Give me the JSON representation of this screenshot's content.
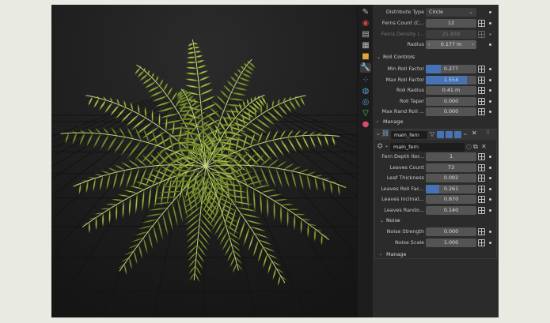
{
  "panel": {
    "top_rows": [
      {
        "label": "Distribute Type",
        "value": "Circle",
        "kind": "dropdown"
      },
      {
        "label": "Ferns Count (C...",
        "value": "12",
        "kind": "number"
      },
      {
        "label": "Ferns Density (...",
        "value": "21.839",
        "kind": "number",
        "disabled": true
      },
      {
        "label": "Radius",
        "value": "0.177 m",
        "kind": "slider"
      }
    ],
    "roll_controls_title": "Roll Controls",
    "roll_rows": [
      {
        "label": "Min Roll Factor",
        "value": "0.277",
        "fill": 0.3
      },
      {
        "label": "Max Roll Factor",
        "value": "1.554",
        "fill": 0.82
      },
      {
        "label": "Roll Radius",
        "value": "0.41 m",
        "fill": 0
      },
      {
        "label": "Roll Taper",
        "value": "0.000",
        "fill": 0
      },
      {
        "label": "Max Rand Roll ...",
        "value": "0.000",
        "fill": 0
      }
    ],
    "manage_label": "Manage",
    "modifier_name": "main_fern",
    "node_group_name": "main_fern",
    "fern_rows": [
      {
        "label": "Fern Depth Iter...",
        "value": "1",
        "fill": 0
      },
      {
        "label": "Leaves Count",
        "value": "73",
        "fill": 0
      },
      {
        "label": "Leaf Thickness",
        "value": "0.092",
        "fill": 0
      },
      {
        "label": "Leaves Roll Fac...",
        "value": "0.261",
        "fill": 0.27
      },
      {
        "label": "Leaves Inclinat...",
        "value": "0.870",
        "fill": 0
      },
      {
        "label": "Leaves Rando...",
        "value": "0.140",
        "fill": 0
      }
    ],
    "noise_title": "Noise",
    "noise_rows": [
      {
        "label": "Noise Strength",
        "value": "0.000",
        "fill": 0
      },
      {
        "label": "Noise Scale",
        "value": "1.000",
        "fill": 0
      }
    ],
    "manage_label_2": "Manage"
  },
  "colors": {
    "accent": "#4772b3",
    "panel_bg": "#2b2b2b",
    "field_bg": "#545454",
    "fern": "#8fa63a"
  },
  "tabs_icons": [
    "tool-icon",
    "render-icon",
    "output-icon",
    "view-layer-icon",
    "scene-icon",
    "world-icon",
    "object-icon",
    "modifier-icon",
    "particles-icon",
    "physics-icon",
    "constraints-icon",
    "data-icon",
    "material-icon"
  ]
}
